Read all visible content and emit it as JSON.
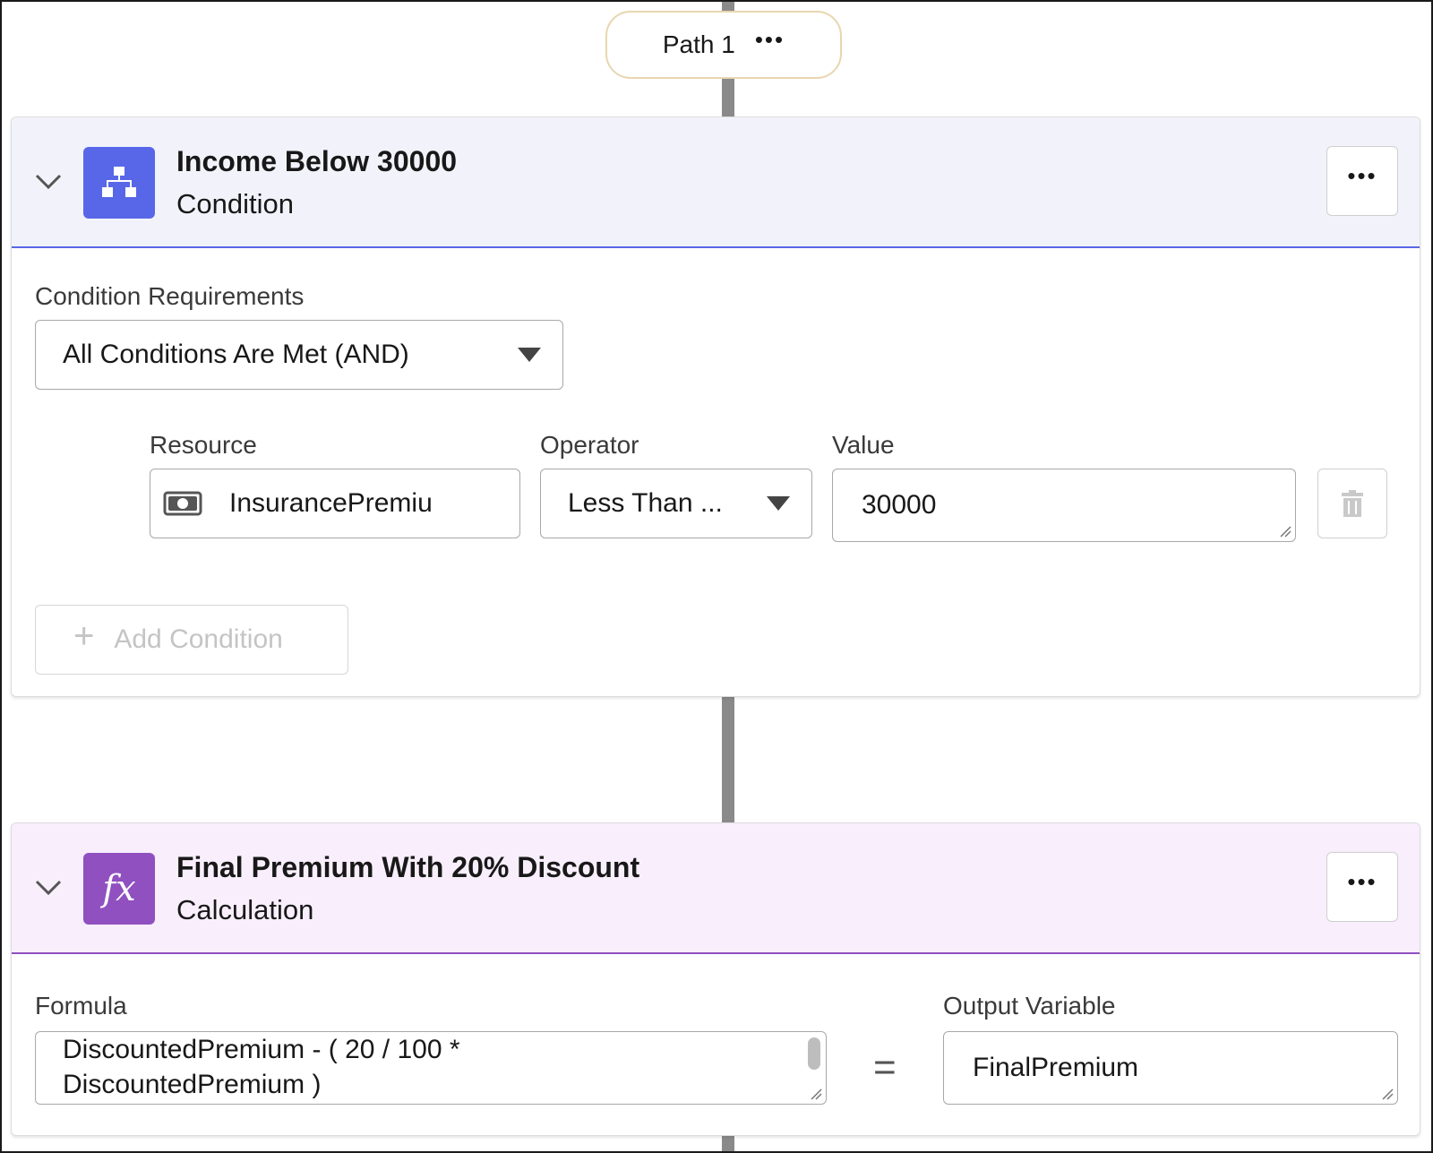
{
  "path": {
    "label": "Path 1",
    "menu": "•••"
  },
  "condition_card": {
    "title": "Income Below 30000",
    "subtitle": "Condition",
    "menu": "•••",
    "requirements_label": "Condition Requirements",
    "requirements_value": "All Conditions Are Met (AND)",
    "resource_label": "Resource",
    "resource_value": "InsurancePremiu",
    "operator_label": "Operator",
    "operator_value": "Less Than ...",
    "value_label": "Value",
    "value_value": "30000",
    "add_condition_label": "Add Condition",
    "add_condition_plus": "+"
  },
  "calc_card": {
    "title": "Final Premium With 20% Discount",
    "subtitle": "Calculation",
    "icon_text": "fx",
    "menu": "•••",
    "formula_label": "Formula",
    "formula_value": "DiscountedPremium - ( 20 / 100 * DiscountedPremium )",
    "equals": "=",
    "output_label": "Output Variable",
    "output_value": "FinalPremium"
  },
  "colors": {
    "condition_accent": "#5867e8",
    "calculation_accent": "#9050c0",
    "connector": "#8a8a8a"
  },
  "icons": [
    "chevron-down-icon",
    "decision-tree-icon",
    "money-icon",
    "trash-icon",
    "fx-icon",
    "plus-icon"
  ]
}
